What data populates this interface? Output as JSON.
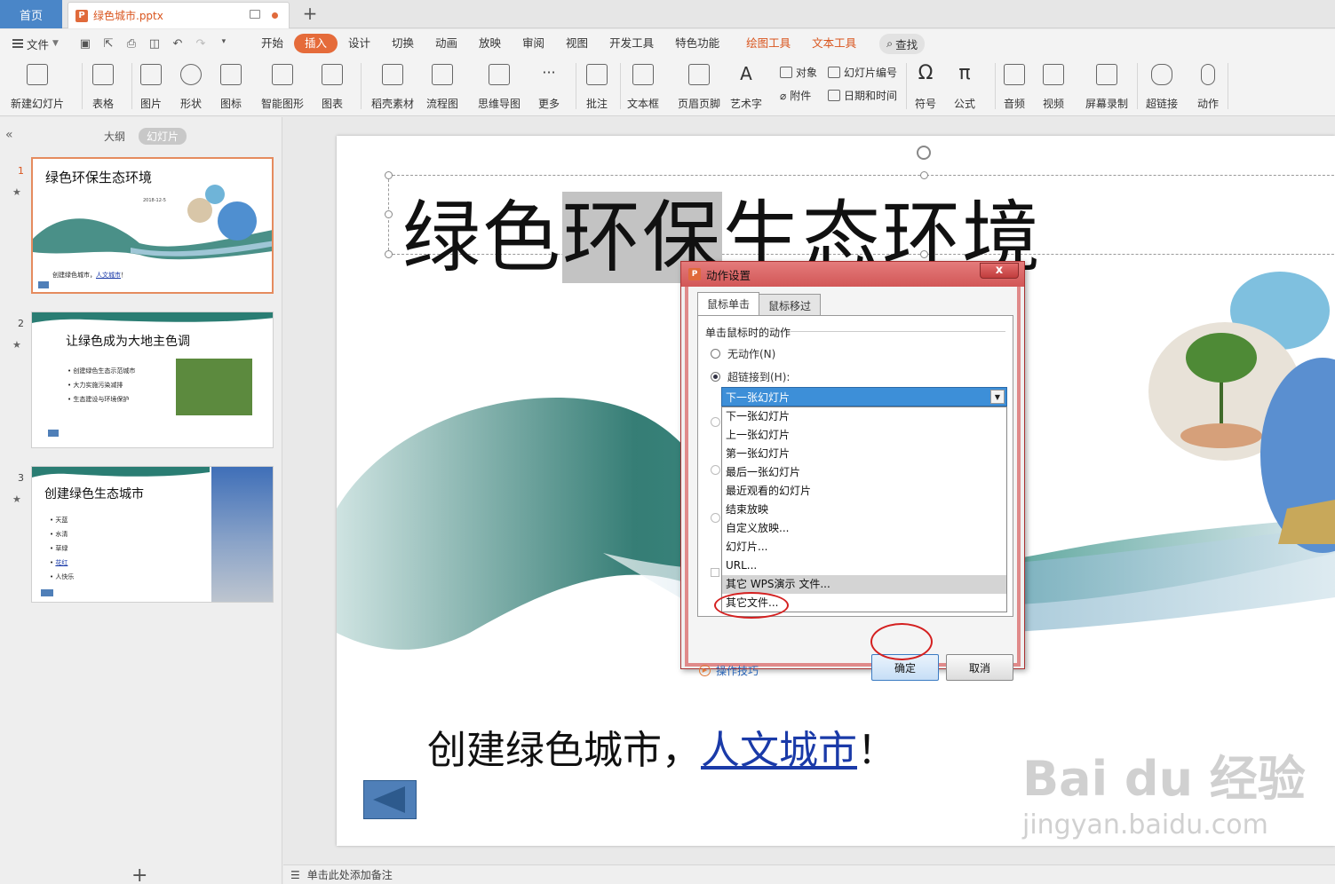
{
  "tabbar": {
    "home_label": "首页",
    "doc_name": "绿色城市.pptx",
    "doc_icon": "P",
    "add_tab": "+"
  },
  "menu": {
    "file_label": "文件",
    "tabs": [
      "开始",
      "插入",
      "设计",
      "切换",
      "动画",
      "放映",
      "审阅",
      "视图",
      "开发工具",
      "特色功能"
    ],
    "active_tab": "插入",
    "context_tabs": [
      "绘图工具",
      "文本工具"
    ],
    "search_label": "查找"
  },
  "ribbon": {
    "buttons": [
      "新建幻灯片",
      "表格",
      "图片",
      "形状",
      "图标",
      "智能图形",
      "图表",
      "稻壳素材",
      "流程图",
      "思维导图",
      "更多",
      "批注",
      "文本框",
      "页眉页脚",
      "艺术字"
    ],
    "small": [
      "对象",
      "幻灯片编号",
      "附件",
      "日期和时间"
    ],
    "buttons2": [
      "符号",
      "公式",
      "音频",
      "视频",
      "屏幕录制",
      "超链接",
      "动作"
    ]
  },
  "leftpanel": {
    "collapse": "«",
    "view_tabs": [
      "大纲",
      "幻灯片"
    ],
    "active_view": "幻灯片",
    "slides": [
      {
        "num": "1",
        "title": "绿色环保生态环境",
        "date": "2018-12-5",
        "footer_text": "创建绿色城市，",
        "footer_link": "人文城市",
        "footer_end": "！"
      },
      {
        "num": "2",
        "title": "让绿色成为大地主色调",
        "bullets": [
          "创建绿色生态示范城市",
          "大力实施污染减排",
          "生态建设与环境保护"
        ]
      },
      {
        "num": "3",
        "title": "创建绿色生态城市",
        "bullets": [
          "天蓝",
          "水清",
          "草绿",
          "花红",
          "人快乐"
        ]
      }
    ],
    "add_slide": "+"
  },
  "slide": {
    "title_before": "绿色",
    "title_selected": "环保",
    "title_after": "生态环境",
    "footer_text": "创建绿色城市，",
    "footer_link": "人文城市",
    "footer_end": "！",
    "watermark_main": "Bai du 经验",
    "watermark_sub": "jingyan.baidu.com"
  },
  "notes": {
    "placeholder": "单击此处添加备注"
  },
  "dialog": {
    "title": "动作设置",
    "close": "x",
    "tabs": [
      "鼠标单击",
      "鼠标移过"
    ],
    "active_tab": "鼠标单击",
    "group_label": "单击鼠标时的动作",
    "radio_none": "无动作(N)",
    "radio_link": "超链接到(H):",
    "selected_value": "下一张幻灯片",
    "options": [
      "下一张幻灯片",
      "上一张幻灯片",
      "第一张幻灯片",
      "最后一张幻灯片",
      "最近观看的幻灯片",
      "结束放映",
      "自定义放映...",
      "幻灯片...",
      "URL...",
      "其它 WPS演示 文件...",
      "其它文件..."
    ],
    "highlighted_option": "其它 WPS演示 文件...",
    "tips": "操作技巧",
    "ok": "确定",
    "cancel": "取消"
  },
  "colors": {
    "accent": "#e56b3a",
    "home_tab": "#4a86c8",
    "link": "#1a3aa8",
    "annotation": "#d42020"
  }
}
